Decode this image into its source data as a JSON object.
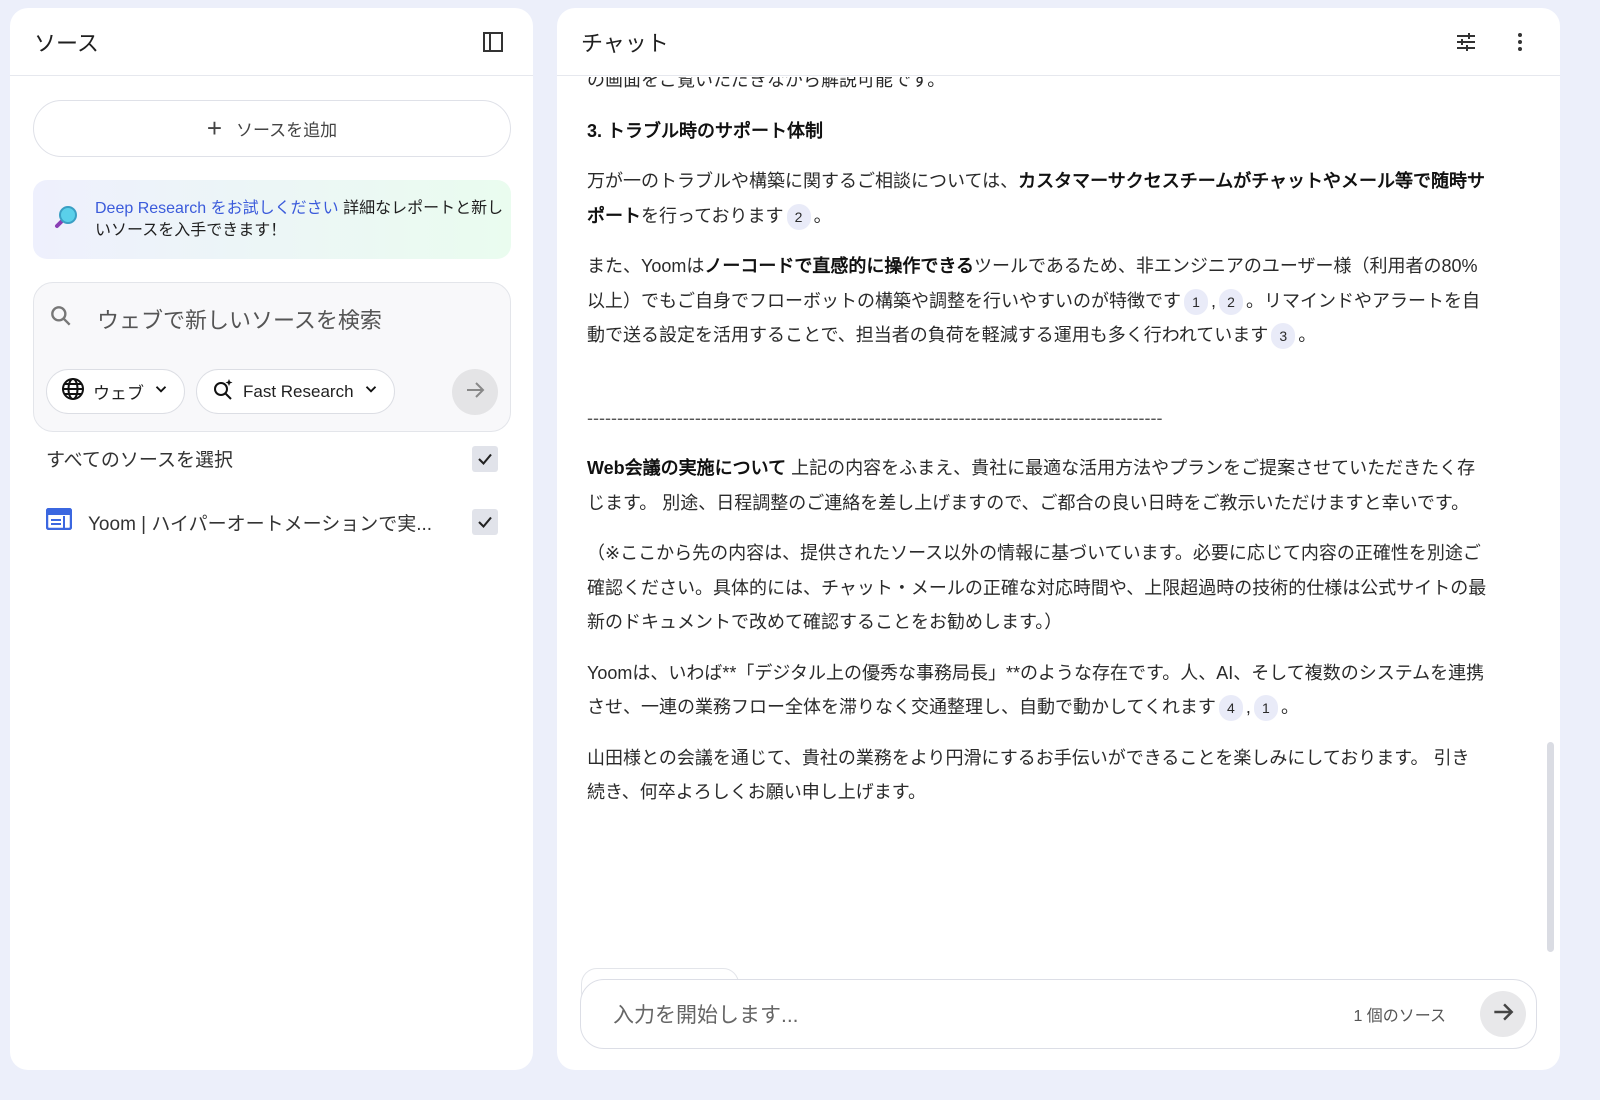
{
  "sources": {
    "title": "ソース",
    "add_label": "ソースを追加",
    "deep": {
      "link": "Deep Research をお試しください",
      "text": " 詳細なレポートと新しいソースを入手できます！"
    },
    "search": {
      "placeholder": "ウェブで新しいソースを検索",
      "web_chip": "ウェブ",
      "mode_chip": "Fast Research"
    },
    "select_all": "すべてのソースを選択",
    "items": [
      {
        "label": "Yoom | ハイパーオートメーションで実..."
      }
    ]
  },
  "chat": {
    "title": "チャット",
    "paragraphs": [
      [
        {
          "t": "の画面をご覧いただきながら解説可能です。"
        }
      ],
      [
        {
          "t": "3. トラブル時のサポート体制",
          "b": true
        }
      ],
      [
        {
          "t": "万が一のトラブルや構築に関するご相談については、"
        },
        {
          "t": "カスタマーサクセスチームがチャットやメール等で随時サポート",
          "b": true
        },
        {
          "t": "を行っております"
        },
        {
          "c": "2"
        },
        {
          "t": "。"
        }
      ],
      [
        {
          "t": "また、Yoomは"
        },
        {
          "t": "ノーコードで直感的に操作できる",
          "b": true
        },
        {
          "t": "ツールであるため、非エンジニアのユーザー様（利用者の80%以上）でもご自身でフローボットの構築や調整を行いやすいのが特徴です"
        },
        {
          "c": "1"
        },
        {
          "t": ","
        },
        {
          "c": "2"
        },
        {
          "t": "。リマインドやアラートを自動で送る設定を活用することで、担当者の負荷を軽減する運用も多く行われています"
        },
        {
          "c": "3"
        },
        {
          "t": "。"
        }
      ],
      [
        {
          "t": "------------------------------------------------------------------------------------------------",
          "dash": true
        }
      ],
      [
        {
          "t": "Web会議の実施について",
          "b": true
        },
        {
          "t": " 上記の内容をふまえ、貴社に最適な活用方法やプランをご提案させていただきたく存じます。 別途、日程調整のご連絡を差し上げますので、ご都合の良い日時をご教示いただけますと幸いです。"
        }
      ],
      [
        {
          "t": "（※ここから先の内容は、提供されたソース以外の情報に基づいています。必要に応じて内容の正確性を別途ご確認ください。具体的には、チャット・メールの正確な対応時間や、上限超過時の技術的仕様は公式サイトの最新のドキュメントで改めて確認することをお勧めします。）"
        }
      ],
      [
        {
          "t": "Yoomは、いわば**「デジタル上の優秀な事務局長」**のような存在です。人、AI、そして複数のシステムを連携させ、一連の業務フロー全体を滞りなく交通整理し、自動で動かしてくれます"
        },
        {
          "c": "4"
        },
        {
          "t": ","
        },
        {
          "c": "1"
        },
        {
          "t": "。"
        }
      ],
      [
        {
          "t": "山田様との会議を通じて、貴社の業務をより円滑にするお手伝いができることを楽しみにしております。 引き続き、何卒よろしくお願い申し上げます。"
        }
      ]
    ],
    "input_placeholder": "入力を開始します...",
    "source_count": "1 個のソース"
  }
}
